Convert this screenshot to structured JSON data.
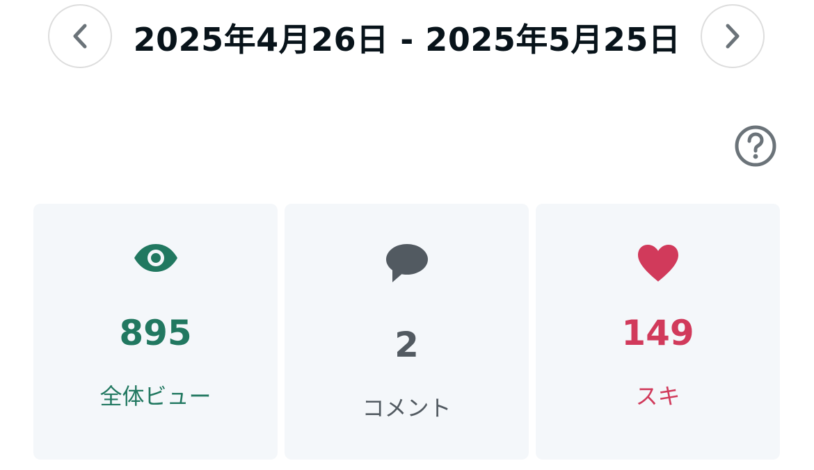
{
  "header": {
    "date_range": "2025年4月26日 - 2025年5月25日",
    "prev_icon": "chevron-left-icon",
    "next_icon": "chevron-right-icon"
  },
  "help": {
    "icon": "question-circle-icon"
  },
  "stats": {
    "views": {
      "icon": "eye-icon",
      "value": "895",
      "label": "全体ビュー",
      "color": "#217860"
    },
    "comments": {
      "icon": "speech-bubble-icon",
      "value": "2",
      "label": "コメント",
      "color": "#525a61"
    },
    "likes": {
      "icon": "heart-icon",
      "value": "149",
      "label": "スキ",
      "color": "#d13a5b"
    }
  },
  "colors": {
    "card_background": "#f4f7fa",
    "nav_border": "#dddddd",
    "nav_chevron": "#6b7379",
    "title_text": "#08131a"
  }
}
